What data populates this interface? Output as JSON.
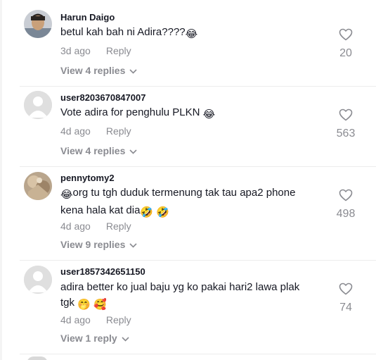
{
  "comments": [
    {
      "username": "Harun Daigo",
      "text": "betul kah bah ni Adira????",
      "emoji": "😂",
      "time": "3d ago",
      "reply_label": "Reply",
      "replies_label": "View 4 replies",
      "likes": "20",
      "avatar": "photo"
    },
    {
      "username": "user8203670847007",
      "text": "Vote adira for penghulu PLKN",
      "emoji": "😂",
      "time": "4d ago",
      "reply_label": "Reply",
      "replies_label": "View 4 replies",
      "likes": "563",
      "avatar": "default"
    },
    {
      "username": "pennytomy2",
      "text_line1": "org tu tgh duduk termenung tak tau apa2 phone",
      "text_line2": "kena hala kat dia",
      "emoji_lead": "😂",
      "emoji_trail1": "🤣",
      "emoji_trail2": "🤣",
      "time": "4d ago",
      "reply_label": "Reply",
      "replies_label": "View 9 replies",
      "likes": "498",
      "avatar": "photo"
    },
    {
      "username": "user1857342651150",
      "text_line1": "adira better ko jual baju yg ko pakai hari2 lawa plak",
      "text_line2": "tgk",
      "emoji_trail1": "🤭",
      "emoji_trail2": "🥰",
      "time": "4d ago",
      "reply_label": "Reply",
      "replies_label": "View 1 reply",
      "likes": "74",
      "avatar": "default"
    }
  ],
  "colors": {
    "text": "#161823",
    "secondary": "#8a8b91",
    "divider": "#ececec"
  },
  "icons": {
    "like": "heart-outline-icon",
    "expand": "chevron-down-icon"
  }
}
